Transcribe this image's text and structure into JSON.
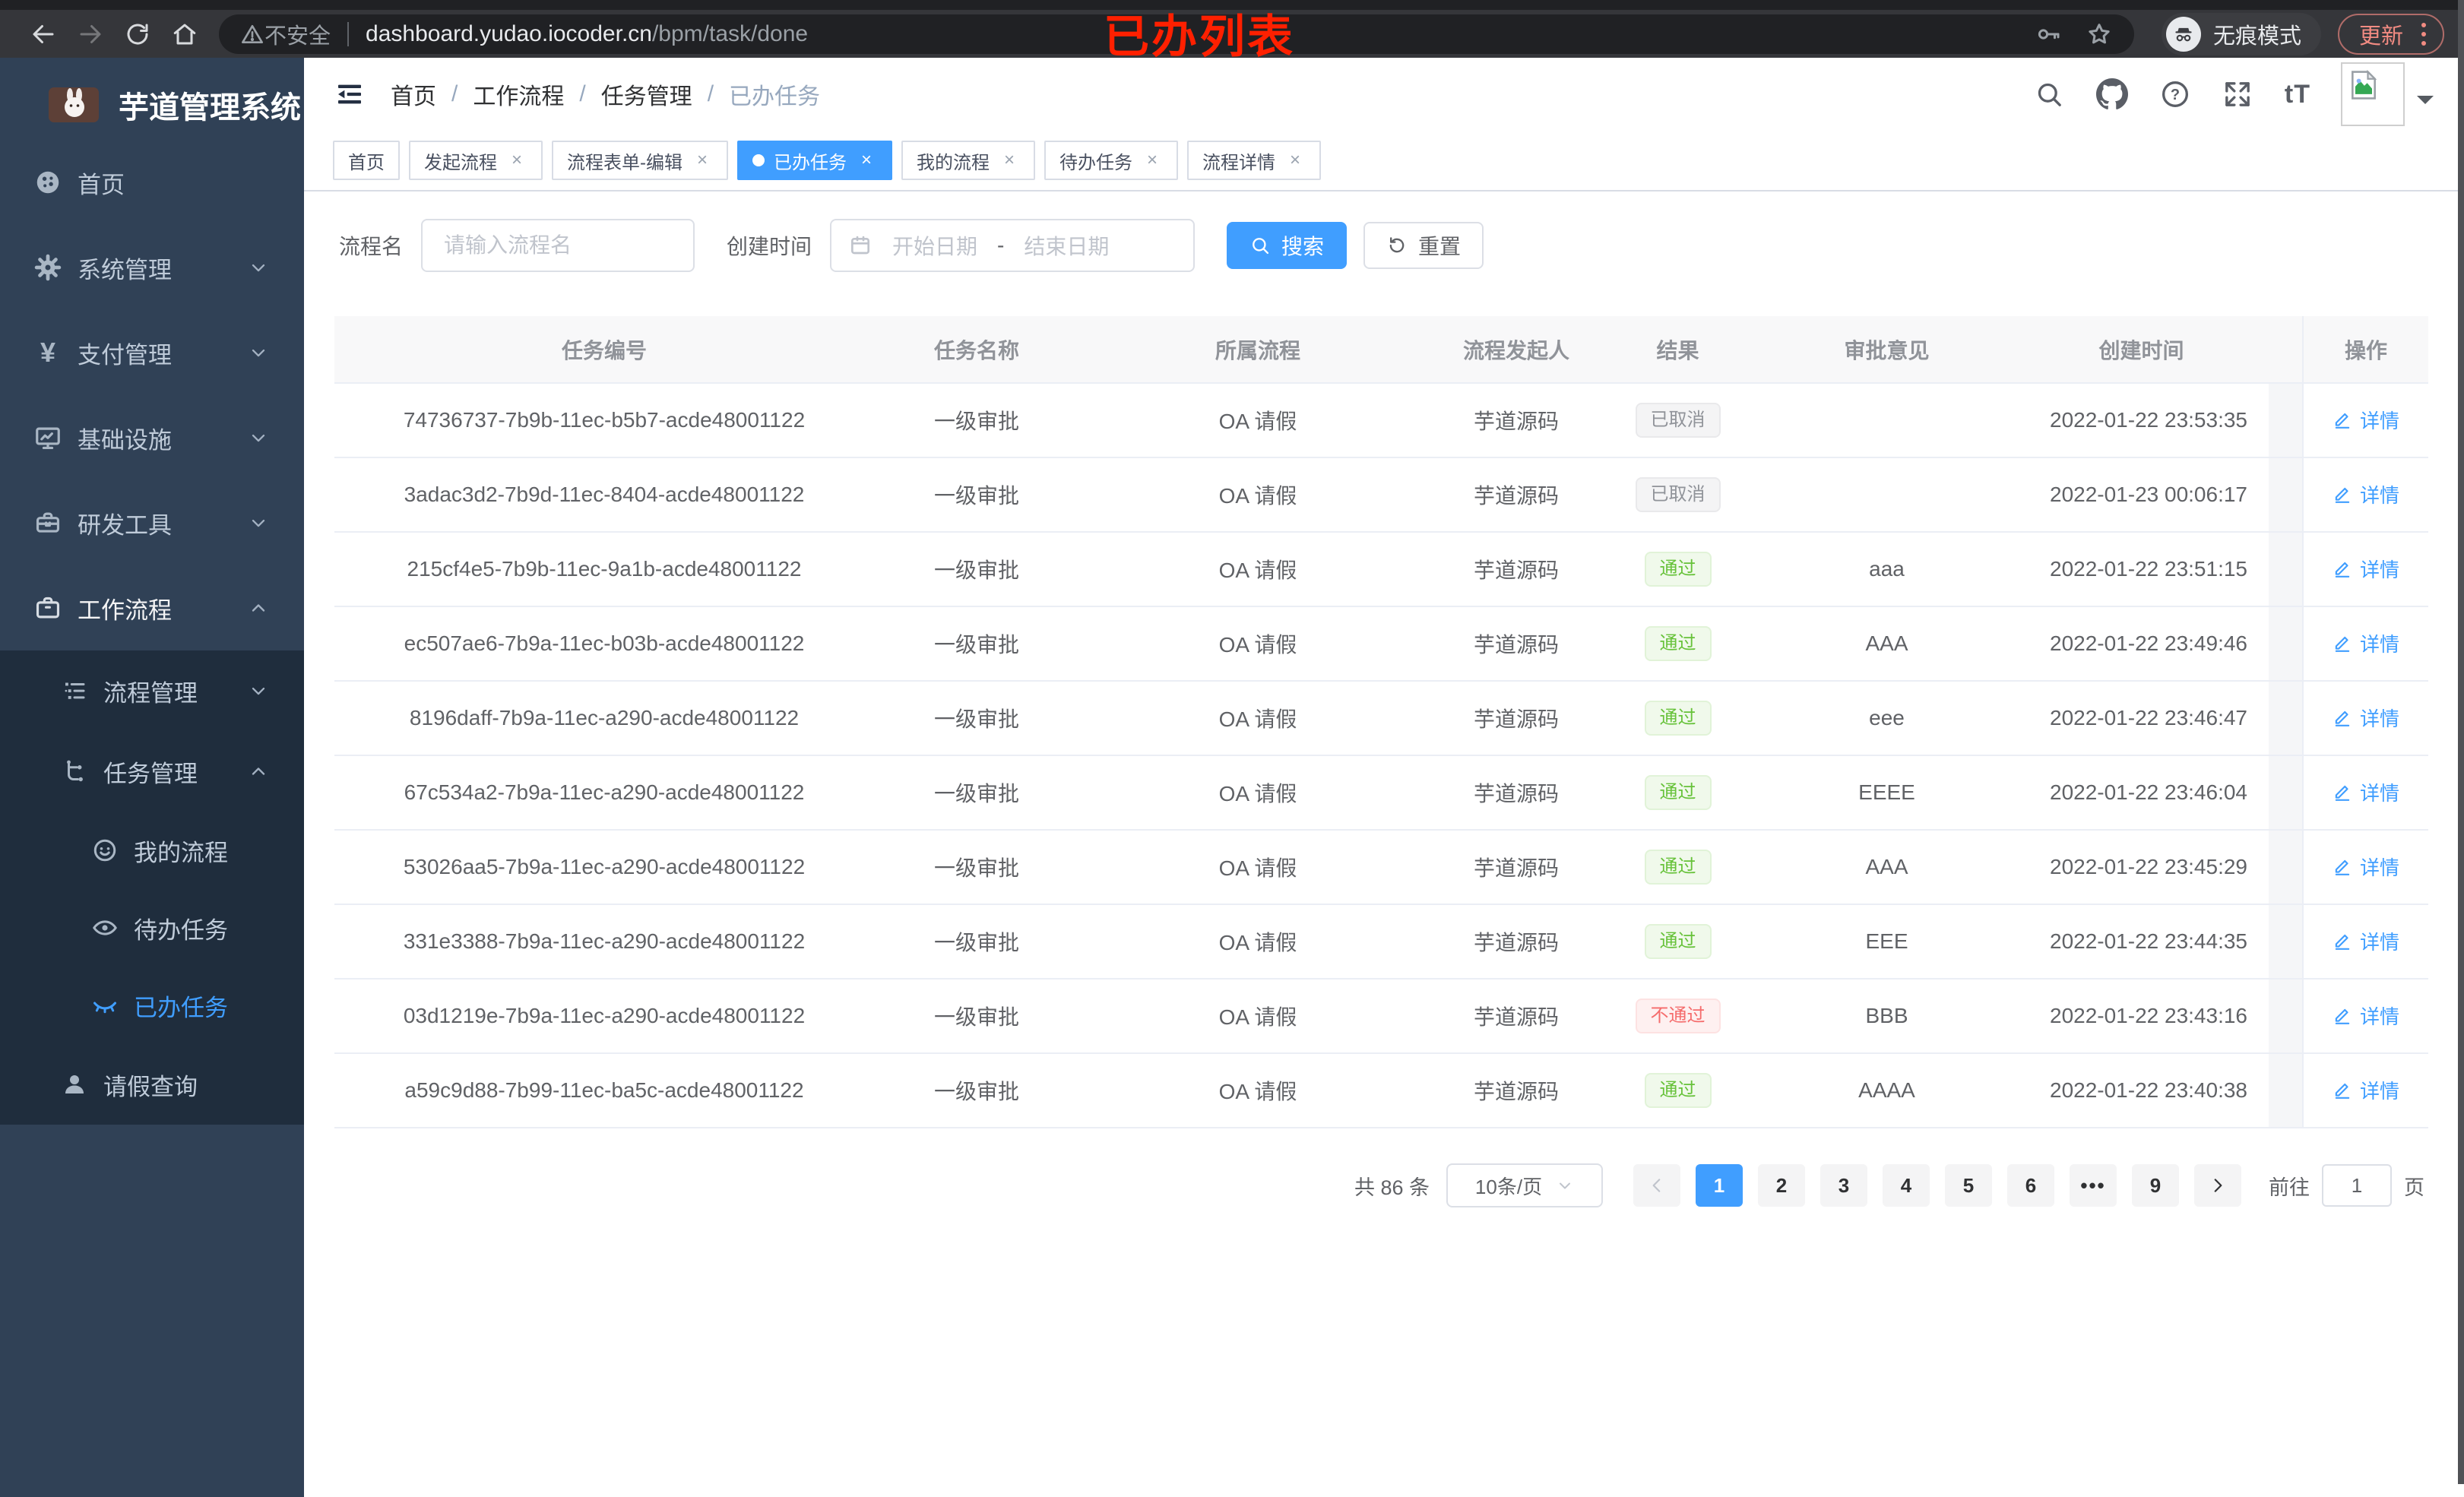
{
  "glyphs": {
    "close": "×",
    "help": "?",
    "font_size_icon": "tT",
    "yen": "¥",
    "breadcrumb_sep": "/"
  },
  "browser": {
    "insecure_label": "不安全",
    "url_host": "dashboard.yudao.iocoder.cn",
    "url_path": "/bpm/task/done",
    "incognito_label": "无痕模式",
    "update_label": "更新"
  },
  "annotation": {
    "text": "已办列表"
  },
  "sidebar": {
    "app_title": "芋道管理系统",
    "items": [
      {
        "label": "首页"
      },
      {
        "label": "系统管理"
      },
      {
        "label": "支付管理"
      },
      {
        "label": "基础设施"
      },
      {
        "label": "研发工具"
      },
      {
        "label": "工作流程"
      }
    ],
    "workflow_children": [
      {
        "label": "流程管理"
      },
      {
        "label": "任务管理"
      }
    ],
    "task_children": [
      {
        "label": "我的流程"
      },
      {
        "label": "待办任务"
      },
      {
        "label": "已办任务"
      }
    ],
    "leave_query": {
      "label": "请假查询"
    }
  },
  "header": {
    "breadcrumbs": [
      "首页",
      "工作流程",
      "任务管理",
      "已办任务"
    ]
  },
  "tabs": [
    {
      "label": "首页"
    },
    {
      "label": "发起流程"
    },
    {
      "label": "流程表单-编辑"
    },
    {
      "label": "已办任务"
    },
    {
      "label": "我的流程"
    },
    {
      "label": "待办任务"
    },
    {
      "label": "流程详情"
    }
  ],
  "filters": {
    "name_label": "流程名",
    "name_placeholder": "请输入流程名",
    "time_label": "创建时间",
    "start_placeholder": "开始日期",
    "range_separator": "-",
    "end_placeholder": "结束日期",
    "search_label": "搜索",
    "reset_label": "重置"
  },
  "table": {
    "columns": [
      "任务编号",
      "任务名称",
      "所属流程",
      "流程发起人",
      "结果",
      "审批意见",
      "创建时间",
      "操作"
    ],
    "action_label": "详情",
    "rows": [
      {
        "id": "74736737-7b9b-11ec-b5b7-acde48001122",
        "name": "一级审批",
        "process": "OA 请假",
        "starter": "芋道源码",
        "result": "已取消",
        "comment": "",
        "time": "2022-01-22 23:53:35"
      },
      {
        "id": "3adac3d2-7b9d-11ec-8404-acde48001122",
        "name": "一级审批",
        "process": "OA 请假",
        "starter": "芋道源码",
        "result": "已取消",
        "comment": "",
        "time": "2022-01-23 00:06:17"
      },
      {
        "id": "215cf4e5-7b9b-11ec-9a1b-acde48001122",
        "name": "一级审批",
        "process": "OA 请假",
        "starter": "芋道源码",
        "result": "通过",
        "comment": "aaa",
        "time": "2022-01-22 23:51:15"
      },
      {
        "id": "ec507ae6-7b9a-11ec-b03b-acde48001122",
        "name": "一级审批",
        "process": "OA 请假",
        "starter": "芋道源码",
        "result": "通过",
        "comment": "AAA",
        "time": "2022-01-22 23:49:46"
      },
      {
        "id": "8196daff-7b9a-11ec-a290-acde48001122",
        "name": "一级审批",
        "process": "OA 请假",
        "starter": "芋道源码",
        "result": "通过",
        "comment": "eee",
        "time": "2022-01-22 23:46:47"
      },
      {
        "id": "67c534a2-7b9a-11ec-a290-acde48001122",
        "name": "一级审批",
        "process": "OA 请假",
        "starter": "芋道源码",
        "result": "通过",
        "comment": "EEEE",
        "time": "2022-01-22 23:46:04"
      },
      {
        "id": "53026aa5-7b9a-11ec-a290-acde48001122",
        "name": "一级审批",
        "process": "OA 请假",
        "starter": "芋道源码",
        "result": "通过",
        "comment": "AAA",
        "time": "2022-01-22 23:45:29"
      },
      {
        "id": "331e3388-7b9a-11ec-a290-acde48001122",
        "name": "一级审批",
        "process": "OA 请假",
        "starter": "芋道源码",
        "result": "通过",
        "comment": "EEE",
        "time": "2022-01-22 23:44:35"
      },
      {
        "id": "03d1219e-7b9a-11ec-a290-acde48001122",
        "name": "一级审批",
        "process": "OA 请假",
        "starter": "芋道源码",
        "result": "不通过",
        "comment": "BBB",
        "time": "2022-01-22 23:43:16"
      },
      {
        "id": "a59c9d88-7b99-11ec-ba5c-acde48001122",
        "name": "一级审批",
        "process": "OA 请假",
        "starter": "芋道源码",
        "result": "通过",
        "comment": "AAAA",
        "time": "2022-01-22 23:40:38"
      }
    ]
  },
  "pagination": {
    "total": "共 86 条",
    "page_size": "10条/页",
    "pages": [
      "1",
      "2",
      "3",
      "4",
      "5",
      "6",
      "•••",
      "9"
    ],
    "goto_label": "前往",
    "goto_value": "1",
    "page_unit": "页"
  },
  "colors": {
    "primary": "#409eff",
    "success": "#67c23a",
    "danger": "#f56c6c",
    "info": "#909399",
    "sidebar_bg": "#304156",
    "submenu_bg": "#1f2d3d"
  }
}
